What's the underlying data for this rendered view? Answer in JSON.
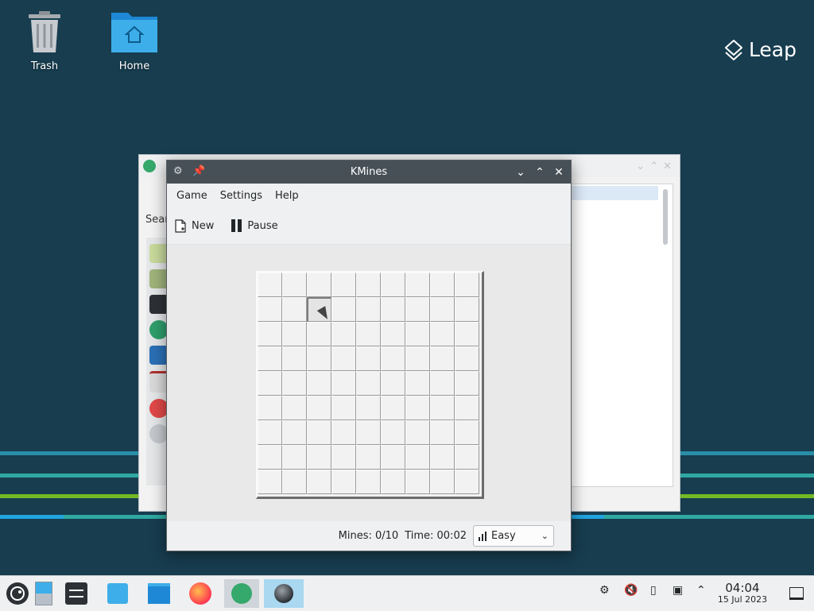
{
  "desktop": {
    "icons": [
      {
        "label": "Trash"
      },
      {
        "label": "Home"
      }
    ],
    "brand": "Leap"
  },
  "bg_window": {
    "search_label": "Sear"
  },
  "kmines": {
    "title": "KMines",
    "menu": [
      "Game",
      "Settings",
      "Help"
    ],
    "toolbar": {
      "new_label": "New",
      "pause_label": "Pause"
    },
    "board": {
      "rows": 9,
      "cols": 9,
      "hover_cell": {
        "row": 1,
        "col": 2
      }
    },
    "status": {
      "mines": "Mines: 0/10",
      "time": "Time: 00:02",
      "difficulty": "Easy"
    }
  },
  "taskbar": {
    "clock_time": "04:04",
    "clock_date": "15 Jul 2023"
  },
  "colors": {
    "desktop_bg": "#173d4f",
    "title_bar": "#475057",
    "accent_teal": "#2fa9a1",
    "accent_green": "#73ba25"
  }
}
